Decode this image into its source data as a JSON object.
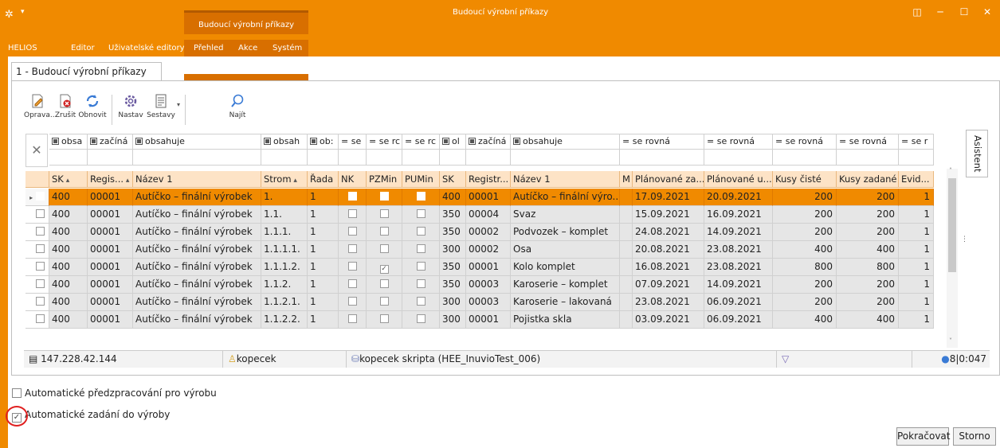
{
  "window": {
    "title": "Budoucí výrobní příkazy",
    "context_tab_title": "Budoucí výrobní příkazy",
    "accent": "#f08a00"
  },
  "ribbon": {
    "tabs": [
      "HELIOS",
      "Editor",
      "Uživatelské editory",
      "Přehled",
      "Akce",
      "Systém"
    ]
  },
  "document_tab": "1 - Budoucí výrobní příkazy",
  "toolbar": {
    "buttons": [
      {
        "label": "Oprava...",
        "icon": "edit-doc-icon"
      },
      {
        "label": "Zrušit",
        "icon": "delete-doc-icon"
      },
      {
        "label": "Obnovit",
        "icon": "refresh-icon"
      },
      {
        "label": "Nastav",
        "icon": "settings-icon"
      },
      {
        "label": "Sestavy",
        "icon": "reports-icon"
      },
      {
        "label": "Najít",
        "icon": "search-icon"
      }
    ]
  },
  "filters": [
    "obsa",
    "začíná",
    "obsahuje",
    "obsah",
    "ob:",
    "= se",
    "= se rc",
    "= se rc",
    "ol",
    "začíná",
    "obsahuje",
    "= se rovná",
    "= se rovná",
    "= se rovná",
    "= se rovná",
    "= se r"
  ],
  "columns": [
    "SK",
    "Regis...",
    "Název 1",
    "Strom",
    "Řada",
    "NK",
    "PZMin",
    "PUMin",
    "SK",
    "Registr...",
    "Název 1",
    "M",
    "Plánované za...",
    "Plánované u...",
    "Kusy čisté",
    "Kusy zadané",
    "Evid..."
  ],
  "rows": [
    {
      "sk": "400",
      "reg": "00001",
      "name": "Autíčko – finální výrobek",
      "strom": "1.",
      "rada": "1",
      "pz": false,
      "sk2": "400",
      "reg2": "00001",
      "name2": "Autíčko – finální výro...",
      "planz": "17.09.2021",
      "planu": "20.09.2021",
      "kc": "200",
      "kz": "200",
      "ev": "1"
    },
    {
      "sk": "400",
      "reg": "00001",
      "name": "Autíčko – finální výrobek",
      "strom": "1.1.",
      "rada": "1",
      "pz": false,
      "sk2": "350",
      "reg2": "00004",
      "name2": "Svaz",
      "planz": "15.09.2021",
      "planu": "16.09.2021",
      "kc": "200",
      "kz": "200",
      "ev": "1"
    },
    {
      "sk": "400",
      "reg": "00001",
      "name": "Autíčko – finální výrobek",
      "strom": "1.1.1.",
      "rada": "1",
      "pz": false,
      "sk2": "350",
      "reg2": "00002",
      "name2": "Podvozek – komplet",
      "planz": "24.08.2021",
      "planu": "14.09.2021",
      "kc": "200",
      "kz": "200",
      "ev": "1"
    },
    {
      "sk": "400",
      "reg": "00001",
      "name": "Autíčko – finální výrobek",
      "strom": "1.1.1.1.",
      "rada": "1",
      "pz": false,
      "sk2": "300",
      "reg2": "00002",
      "name2": "Osa",
      "planz": "20.08.2021",
      "planu": "23.08.2021",
      "kc": "400",
      "kz": "400",
      "ev": "1"
    },
    {
      "sk": "400",
      "reg": "00001",
      "name": "Autíčko – finální výrobek",
      "strom": "1.1.1.2.",
      "rada": "1",
      "pz": true,
      "sk2": "350",
      "reg2": "00001",
      "name2": "Kolo komplet",
      "planz": "16.08.2021",
      "planu": "23.08.2021",
      "kc": "800",
      "kz": "800",
      "ev": "1"
    },
    {
      "sk": "400",
      "reg": "00001",
      "name": "Autíčko – finální výrobek",
      "strom": "1.1.2.",
      "rada": "1",
      "pz": false,
      "sk2": "350",
      "reg2": "00003",
      "name2": "Karoserie – komplet",
      "planz": "07.09.2021",
      "planu": "14.09.2021",
      "kc": "200",
      "kz": "200",
      "ev": "1"
    },
    {
      "sk": "400",
      "reg": "00001",
      "name": "Autíčko – finální výrobek",
      "strom": "1.1.2.1.",
      "rada": "1",
      "pz": false,
      "sk2": "300",
      "reg2": "00003",
      "name2": "Karoserie – lakovaná",
      "planz": "23.08.2021",
      "planu": "06.09.2021",
      "kc": "200",
      "kz": "200",
      "ev": "1"
    },
    {
      "sk": "400",
      "reg": "00001",
      "name": "Autíčko – finální výrobek",
      "strom": "1.1.2.2.",
      "rada": "1",
      "pz": false,
      "sk2": "300",
      "reg2": "00001",
      "name2": "Pojistka skla",
      "planz": "03.09.2021",
      "planu": "06.09.2021",
      "kc": "400",
      "kz": "400",
      "ev": "1"
    }
  ],
  "side_panel": "Asistent",
  "status": {
    "ip": "147.228.42.144",
    "user": "kopecek",
    "database": "kopecek skripta (HEE_InuvioTest_006)",
    "info": "8|0:047"
  },
  "options": {
    "auto_preprocess": "Automatické předzpracování pro výrobu",
    "auto_preprocess_checked": false,
    "auto_submit": "Automatické zadání do výroby",
    "auto_submit_checked": true
  },
  "buttons": {
    "continue": "Pokračovat",
    "cancel": "Storno"
  }
}
